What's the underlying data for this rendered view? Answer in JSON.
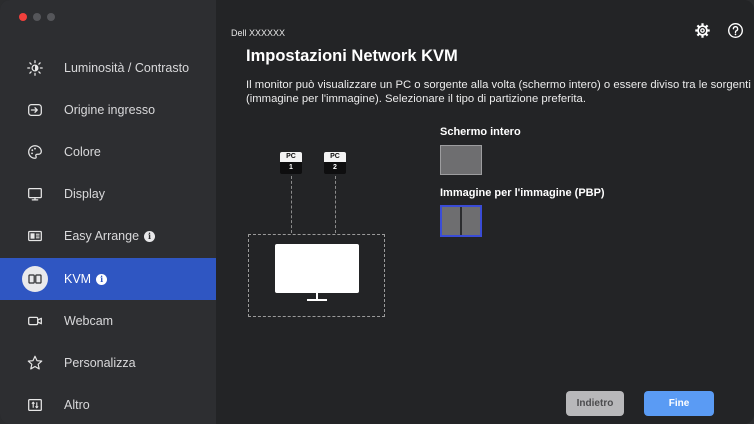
{
  "sidebar": {
    "items": [
      {
        "label": "Luminosità / Contrasto",
        "icon": "brightness-icon",
        "info": false,
        "active": false
      },
      {
        "label": "Origine ingresso",
        "icon": "input-source-icon",
        "info": false,
        "active": false
      },
      {
        "label": "Colore",
        "icon": "palette-icon",
        "info": false,
        "active": false
      },
      {
        "label": "Display",
        "icon": "display-icon",
        "info": false,
        "active": false
      },
      {
        "label": "Easy Arrange",
        "icon": "easy-arrange-icon",
        "info": true,
        "active": false
      },
      {
        "label": "KVM",
        "icon": "kvm-icon",
        "info": true,
        "active": true
      },
      {
        "label": "Webcam",
        "icon": "webcam-icon",
        "info": false,
        "active": false
      },
      {
        "label": "Personalizza",
        "icon": "star-icon",
        "info": false,
        "active": false
      },
      {
        "label": "Altro",
        "icon": "others-icon",
        "info": false,
        "active": false
      }
    ]
  },
  "header": {
    "monitor_name": "Dell XXXXXX"
  },
  "main": {
    "title": "Impostazioni Network KVM",
    "description": "Il monitor può visualizzare un PC o sorgente alla volta (schermo intero) o essere diviso tra le sorgenti (immagine per l'immagine). Selezionare il tipo di partizione preferita.",
    "diagram": {
      "pc1": {
        "tag": "PC",
        "num": "1"
      },
      "pc2": {
        "tag": "PC",
        "num": "2"
      }
    },
    "options": {
      "full_label": "Schermo intero",
      "pbp_label": "Immagine per l'immagine (PBP)",
      "selected": "pbp"
    }
  },
  "buttons": {
    "back": "Indietro",
    "done": "Fine"
  },
  "colors": {
    "accent": "#2f56c2",
    "done_button": "#5a9bf4",
    "selection_border": "#3a4cd6"
  }
}
